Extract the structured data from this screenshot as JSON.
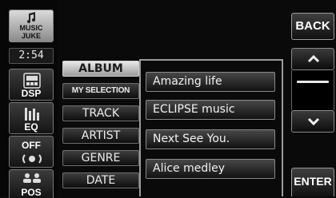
{
  "left_panel": {
    "music_juke_label": "MUSIC\nJUKE",
    "clock": "2:54",
    "dsp_label": "DSP",
    "eq_label": "EQ",
    "off_label": "OFF",
    "pos_label": "POS"
  },
  "categories": [
    {
      "label": "ALBUM",
      "active": true
    },
    {
      "label": "MY SELECTION",
      "active": false
    },
    {
      "label": "TRACK",
      "active": false
    },
    {
      "label": "ARTIST",
      "active": false
    },
    {
      "label": "GENRE",
      "active": false
    },
    {
      "label": "DATE",
      "active": false
    }
  ],
  "list": {
    "items": [
      "Amazing life",
      "ECLIPSE music",
      "Next See You.",
      "Alice medley"
    ]
  },
  "right_panel": {
    "back_label": "BACK",
    "enter_label": "ENTER"
  },
  "icons": {
    "music_juke": "music-note-icon",
    "dsp": "dsp-icon",
    "eq": "equalizer-icon",
    "off": "speaker-off-icon",
    "pos": "listener-position-icon",
    "scroll_up": "chevron-up-icon",
    "scroll_down": "chevron-down-icon"
  },
  "colors": {
    "background": "#0a0a0a",
    "button_gradient_top": "#3d3d3d",
    "button_gradient_bottom": "#0e0e0e",
    "active_gradient_top": "#e9e9e9",
    "active_gradient_bottom": "#9b9b9b",
    "text": "#f2f2f2"
  }
}
